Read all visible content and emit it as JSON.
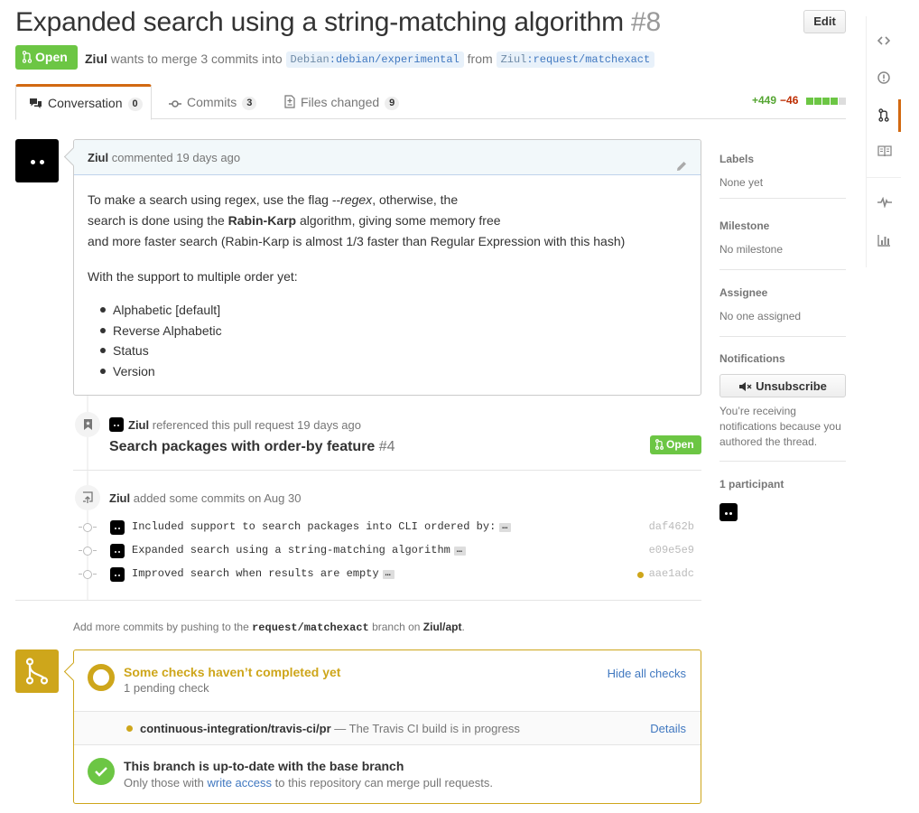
{
  "header": {
    "title": "Expanded search using a string-matching algorithm",
    "number": "#8",
    "edit_label": "Edit",
    "state": "Open",
    "author": "Ziul",
    "merge_text": "wants to merge 3 commits into",
    "base_owner": "Debian",
    "base_branch": "debian/experimental",
    "from_text": "from",
    "head_owner": "Ziul",
    "head_branch": "request/matchexact"
  },
  "tabs": [
    {
      "label": "Conversation",
      "count": "0"
    },
    {
      "label": "Commits",
      "count": "3"
    },
    {
      "label": "Files changed",
      "count": "9"
    }
  ],
  "diffstat": {
    "additions": "+449",
    "deletions": "−46"
  },
  "comment": {
    "author": "Ziul",
    "action": "commented 19 days ago",
    "line1_a": "To make a search using regex, use the flag --",
    "line1_em": "regex",
    "line1_b": ", otherwise, the",
    "line2_a": "search is done using the ",
    "line2_b": "Rabin-Karp",
    "line2_c": " algorithm, giving some memory free",
    "line3": "and more faster search (Rabin-Karp is almost 1/3 faster than Regular Expression with this hash)",
    "line4": "With the support to multiple order yet:",
    "list": [
      "Alphabetic [default]",
      "Reverse Alphabetic",
      "Status",
      "Version"
    ]
  },
  "reference": {
    "author": "Ziul",
    "action": "referenced this pull request 19 days ago",
    "title": "Search packages with order-by feature",
    "number": "#4",
    "state": "Open"
  },
  "commits_event": {
    "author": "Ziul",
    "action": "added some commits on Aug 30",
    "commits": [
      {
        "message": "Included support to search packages into CLI ordered by:",
        "sha": "daf462b"
      },
      {
        "message": "Expanded search using a string-matching algorithm",
        "sha": "e09e5e9"
      },
      {
        "message": "Improved search when results are empty",
        "sha": "aae1adc"
      }
    ]
  },
  "push_hint": {
    "prefix": "Add more commits by pushing to the",
    "branch": "request/matchexact",
    "middle": "branch on",
    "repo": "Ziul/apt",
    "suffix": "."
  },
  "merge": {
    "checks_title": "Some checks haven’t completed yet",
    "checks_sub": "1 pending check",
    "hide_label": "Hide all checks",
    "check_name": "continuous-integration/travis-ci/pr",
    "check_desc": "— The Travis CI build is in progress",
    "details_label": "Details",
    "ok_title": "This branch is up-to-date with the base branch",
    "ok_sub_a": "Only those with",
    "ok_sub_link": "write access",
    "ok_sub_b": "to this repository can merge pull requests."
  },
  "sidebar": {
    "labels_head": "Labels",
    "labels_val": "None yet",
    "milestone_head": "Milestone",
    "milestone_val": "No milestone",
    "assignee_head": "Assignee",
    "assignee_val": "No one assigned",
    "notifications_head": "Notifications",
    "unsubscribe_label": "Unsubscribe",
    "notif_text": "You’re receiving notifications because you authored the thread.",
    "participants_head": "1 participant"
  },
  "colors": {
    "open_green": "#6cc644",
    "pending_yellow": "#cea61b",
    "tab_orange": "#d26911",
    "link_blue": "#4078c0"
  },
  "icons": [
    "code-icon",
    "issue-icon",
    "pull-request-icon",
    "wiki-icon",
    "pulse-icon",
    "graph-icon",
    "pencil-icon",
    "mute-icon",
    "check-icon",
    "git-branch-icon",
    "bookmark-icon",
    "repo-push-icon",
    "comment-discussion-icon",
    "git-commit-icon",
    "diff-icon"
  ]
}
